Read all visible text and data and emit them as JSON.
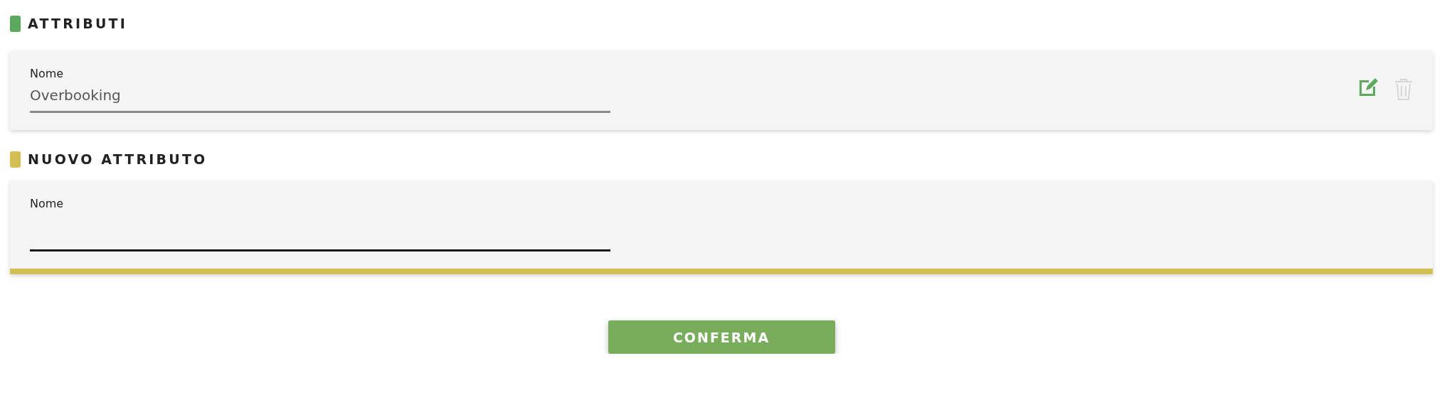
{
  "sections": [
    {
      "title": "ATTRIBUTI",
      "color": "#5aa95d",
      "cards": [
        {
          "kind": "existing",
          "field": {
            "label": "Nome",
            "value": "Overbooking"
          },
          "actions": [
            {
              "kind": "edit",
              "disabled": false
            },
            {
              "kind": "delete",
              "disabled": true
            }
          ]
        }
      ]
    },
    {
      "title": "NUOVO ATTRIBUTO",
      "color": "#d4bf55",
      "cards": [
        {
          "kind": "new",
          "field": {
            "label": "Nome"
          }
        }
      ]
    }
  ],
  "button": {
    "label": "CONFERMA"
  }
}
